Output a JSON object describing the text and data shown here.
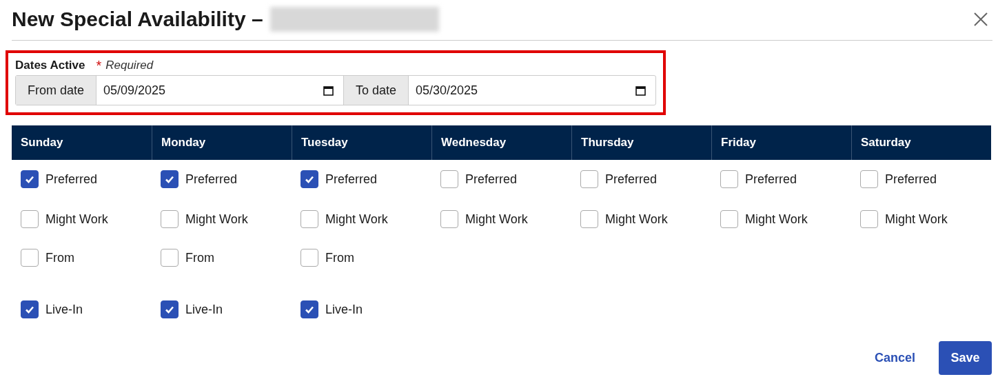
{
  "dialog": {
    "title": "New Special Availability –"
  },
  "dates_active": {
    "label": "Dates Active",
    "required_mark": "*",
    "required_text": "Required",
    "highlighted": true,
    "from": {
      "label": "From date",
      "value": "05/09/2025"
    },
    "to": {
      "label": "To date",
      "value": "05/30/2025"
    }
  },
  "days": [
    {
      "name": "Sunday",
      "options": [
        {
          "label": "Preferred",
          "checked": true
        },
        {
          "label": "Might Work",
          "checked": false
        },
        {
          "label": "From",
          "checked": false
        },
        {
          "label": "Live-In",
          "checked": true
        }
      ]
    },
    {
      "name": "Monday",
      "options": [
        {
          "label": "Preferred",
          "checked": true
        },
        {
          "label": "Might Work",
          "checked": false
        },
        {
          "label": "From",
          "checked": false
        },
        {
          "label": "Live-In",
          "checked": true
        }
      ]
    },
    {
      "name": "Tuesday",
      "options": [
        {
          "label": "Preferred",
          "checked": true
        },
        {
          "label": "Might Work",
          "checked": false
        },
        {
          "label": "From",
          "checked": false
        },
        {
          "label": "Live-In",
          "checked": true
        }
      ]
    },
    {
      "name": "Wednesday",
      "options": [
        {
          "label": "Preferred",
          "checked": false
        },
        {
          "label": "Might Work",
          "checked": false
        }
      ]
    },
    {
      "name": "Thursday",
      "options": [
        {
          "label": "Preferred",
          "checked": false
        },
        {
          "label": "Might Work",
          "checked": false
        }
      ]
    },
    {
      "name": "Friday",
      "options": [
        {
          "label": "Preferred",
          "checked": false
        },
        {
          "label": "Might Work",
          "checked": false
        }
      ]
    },
    {
      "name": "Saturday",
      "options": [
        {
          "label": "Preferred",
          "checked": false
        },
        {
          "label": "Might Work",
          "checked": false
        }
      ]
    }
  ],
  "buttons": {
    "cancel": "Cancel",
    "save": "Save"
  }
}
